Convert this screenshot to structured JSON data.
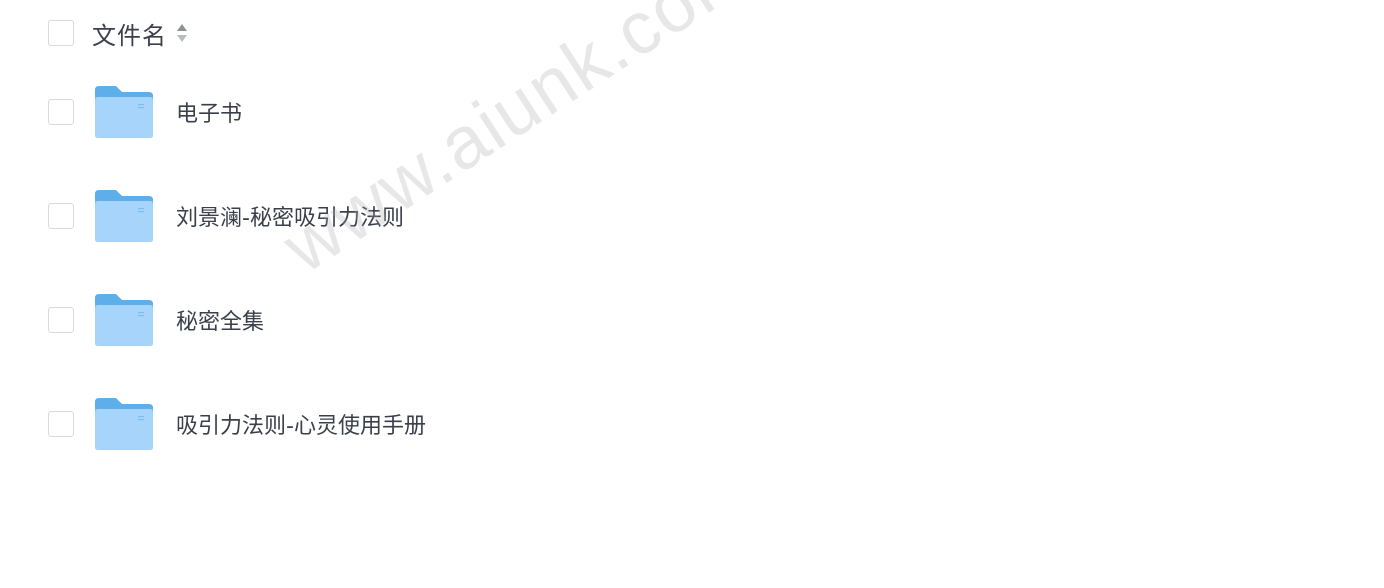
{
  "header": {
    "column_label": "文件名"
  },
  "files": [
    {
      "name": "电子书",
      "icon": "folder-icon"
    },
    {
      "name": "刘景澜-秘密吸引力法则",
      "icon": "folder-icon"
    },
    {
      "name": "秘密全集",
      "icon": "folder-icon"
    },
    {
      "name": "吸引力法则-心灵使用手册",
      "icon": "folder-icon"
    }
  ],
  "watermark": "www.aiunk.com",
  "colors": {
    "folder_back": "#5eaeea",
    "folder_front": "#a6d4fb",
    "text": "#3a3f4a",
    "checkbox_border": "#d6d9de"
  }
}
